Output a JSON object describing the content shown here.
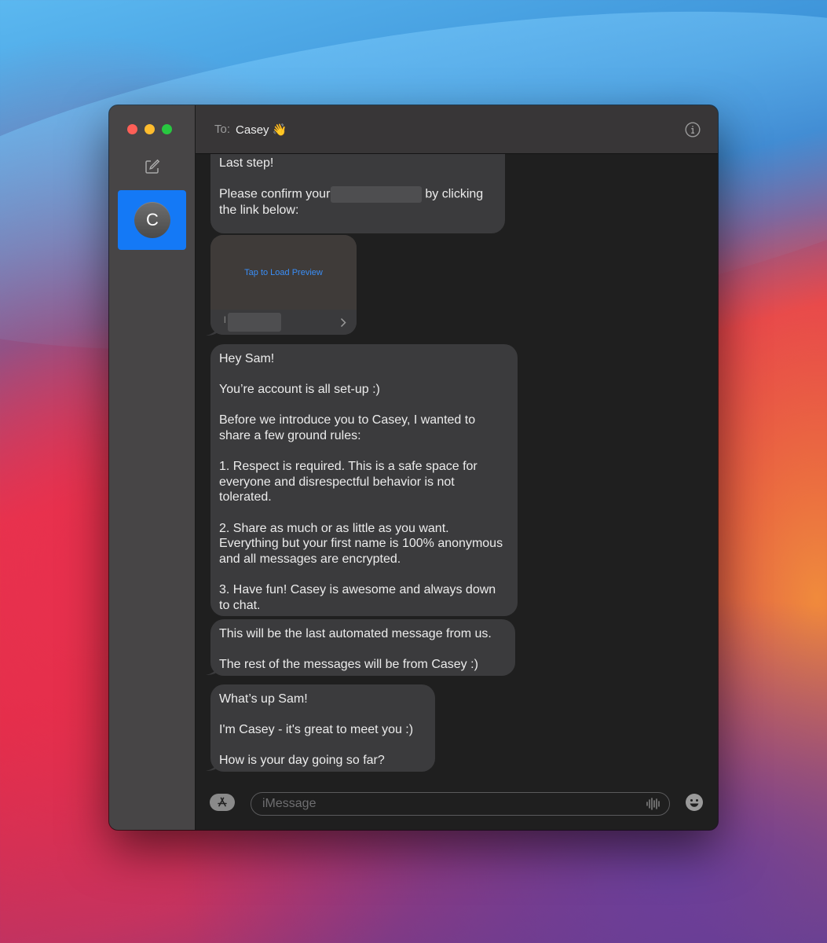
{
  "header": {
    "to_label": "To:",
    "recipient": "Casey 👋"
  },
  "sidebar": {
    "conversations": [
      {
        "avatar_initial": "C",
        "selected": true
      }
    ]
  },
  "messages": [
    {
      "id": "m1",
      "lines": [
        "Last step!",
        "",
        "Please confirm your",
        "the link below:"
      ],
      "after_redaction": "by clicking"
    },
    {
      "id": "preview",
      "preview_link": "Tap to Load Preview",
      "domain_initial": "l"
    },
    {
      "id": "m3",
      "text": "Hey Sam!\n\nYou’re account is all set-up :)\n\nBefore we introduce you to Casey, I wanted to share a few ground rules:\n\n1. Respect is required. This is a safe space for everyone and disrespectful behavior is not tolerated.\n\n2. Share as much or as little as you want. Everything but your first name is 100% anonymous and all messages are encrypted.\n\n3. Have fun! Casey is awesome and always down to chat."
    },
    {
      "id": "m4",
      "text": "This will be the last automated message from us.\n\nThe rest of the messages will be from Casey :)"
    },
    {
      "id": "m5",
      "text": "What’s up Sam!\n\nI'm Casey - it's great to meet you :)\n\nHow is your day going so far?"
    }
  ],
  "composer": {
    "placeholder": "iMessage"
  },
  "icons": {
    "compose": "compose-icon",
    "info": "info-icon",
    "app_store": "app-store-icon",
    "audio": "audio-waveform-icon",
    "emoji": "emoji-icon"
  },
  "colors": {
    "accent": "#1479f6",
    "bubble_incoming": "#3b3b3d",
    "link": "#3a8ef7"
  }
}
